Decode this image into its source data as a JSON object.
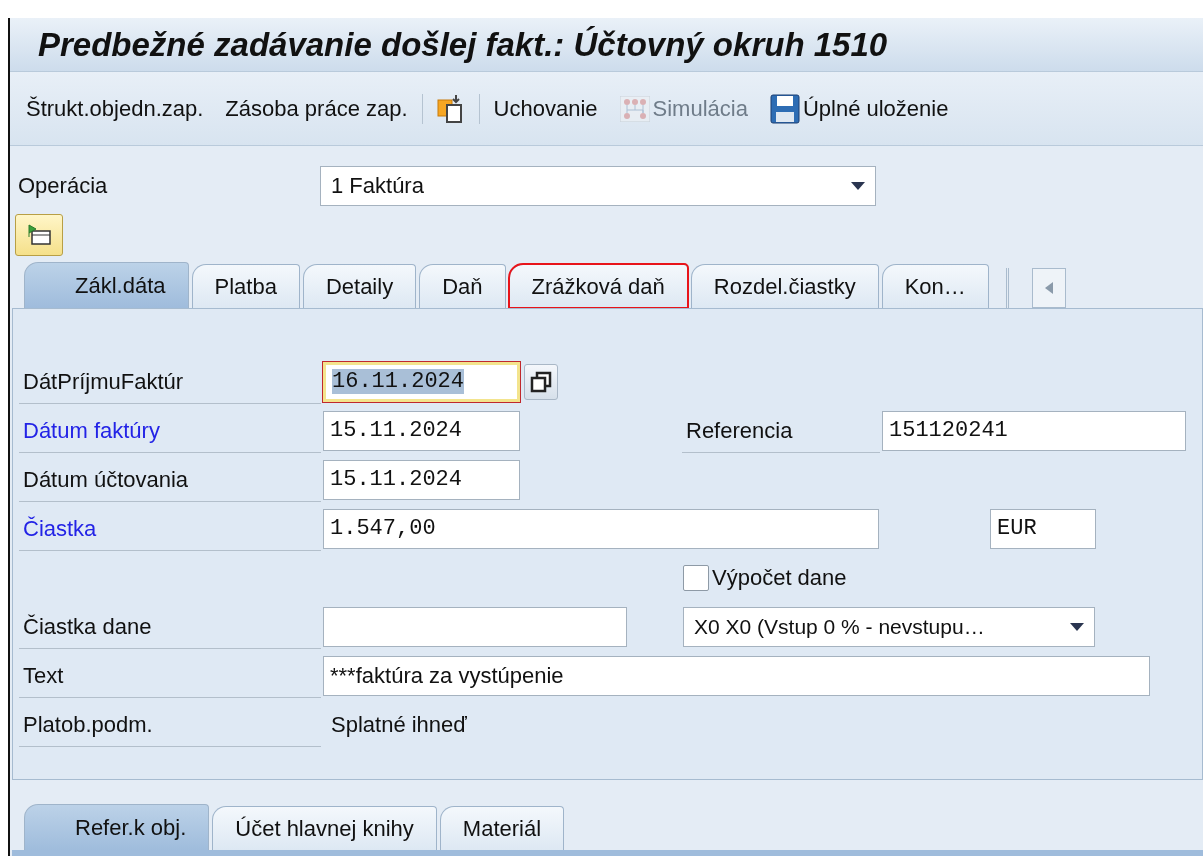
{
  "window": {
    "title": "Predbežné zadávanie došlej fakt.: Účtovný okruh 1510"
  },
  "toolbar": [
    {
      "kind": "text",
      "label": "Štrukt.objedn.zap.",
      "disabled": false
    },
    {
      "kind": "text",
      "label": "Zásoba práce zap.",
      "disabled": false
    },
    {
      "kind": "separator"
    },
    {
      "kind": "icon",
      "disabled": false
    },
    {
      "kind": "separator"
    },
    {
      "kind": "text",
      "label": "Uchovanie",
      "disabled": false
    },
    {
      "kind": "simulate",
      "label": "Simulácia",
      "disabled": true
    },
    {
      "kind": "save",
      "label": "Úplné uloženie",
      "disabled": false
    }
  ],
  "operation": {
    "label": "Operácia",
    "value": "1 Faktúra"
  },
  "tabs": [
    {
      "label": "Zákl.dáta",
      "selected": true,
      "highlighted": false
    },
    {
      "label": "Platba",
      "selected": false,
      "highlighted": false
    },
    {
      "label": "Detaily",
      "selected": false,
      "highlighted": false
    },
    {
      "label": "Daň",
      "selected": false,
      "highlighted": false
    },
    {
      "label": "Zrážková daň",
      "selected": false,
      "highlighted": true
    },
    {
      "label": "Rozdel.čiastky",
      "selected": false,
      "highlighted": false
    },
    {
      "label": "Kon…",
      "selected": false,
      "highlighted": false
    }
  ],
  "form": {
    "receipt_date": {
      "label": "DátPríjmuFaktúr",
      "value": "16.11.2024",
      "focused": true,
      "required": false
    },
    "invoice_date": {
      "label": "Dátum faktúry",
      "value": "15.11.2024",
      "focused": false,
      "required": true
    },
    "reference": {
      "label": "Referencia",
      "value": "151120241"
    },
    "posting_date": {
      "label": "Dátum účtovania",
      "value": "15.11.2024",
      "focused": false,
      "required": false
    },
    "amount": {
      "label": "Čiastka",
      "value": "1.547,00",
      "required": true
    },
    "currency": {
      "value": "EUR"
    },
    "calculate_tax": {
      "label": "Výpočet dane",
      "checked": false
    },
    "tax_amount": {
      "label": "Čiastka dane"
    },
    "tax_code": {
      "value": "X0 X0 (Vstup 0 % - nevstupu…"
    },
    "text": {
      "label": "Text",
      "value": "***faktúra za vystúpenie"
    },
    "payment_terms": {
      "label": "Platob.podm.",
      "value": "Splatné ihneď"
    }
  },
  "bottom_tabs": [
    {
      "label": "Refer.k obj.",
      "selected": true
    },
    {
      "label": "Účet hlavnej knihy",
      "selected": false
    },
    {
      "label": "Materiál",
      "selected": false
    }
  ]
}
